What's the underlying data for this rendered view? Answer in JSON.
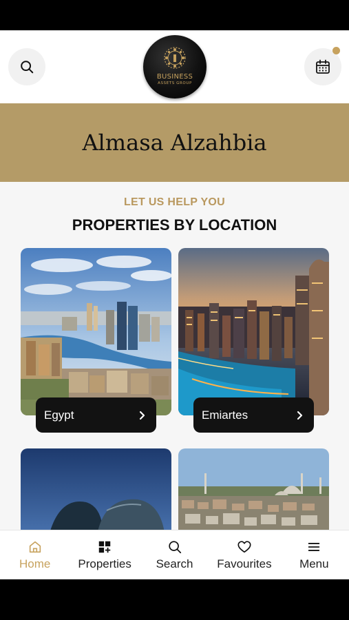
{
  "header": {
    "logo_name": "BUSINESS",
    "logo_sub": "ASSETS GROUP",
    "search_icon": "search-icon",
    "calendar_icon": "calendar-icon"
  },
  "banner": {
    "title": "Almasa Alzahbia"
  },
  "section": {
    "kicker": "LET US HELP YOU",
    "title": "PROPERTIES BY LOCATION"
  },
  "locations": [
    {
      "label": "Egypt"
    },
    {
      "label": "Emiartes"
    }
  ],
  "tabs": [
    {
      "label": "Home",
      "icon": "home-icon",
      "active": true
    },
    {
      "label": "Properties",
      "icon": "grid-icon",
      "active": false
    },
    {
      "label": "Search",
      "icon": "search-icon",
      "active": false
    },
    {
      "label": "Favourites",
      "icon": "heart-icon",
      "active": false
    },
    {
      "label": "Menu",
      "icon": "menu-icon",
      "active": false
    }
  ],
  "colors": {
    "accent": "#c7a25e",
    "banner": "#b49b67"
  }
}
